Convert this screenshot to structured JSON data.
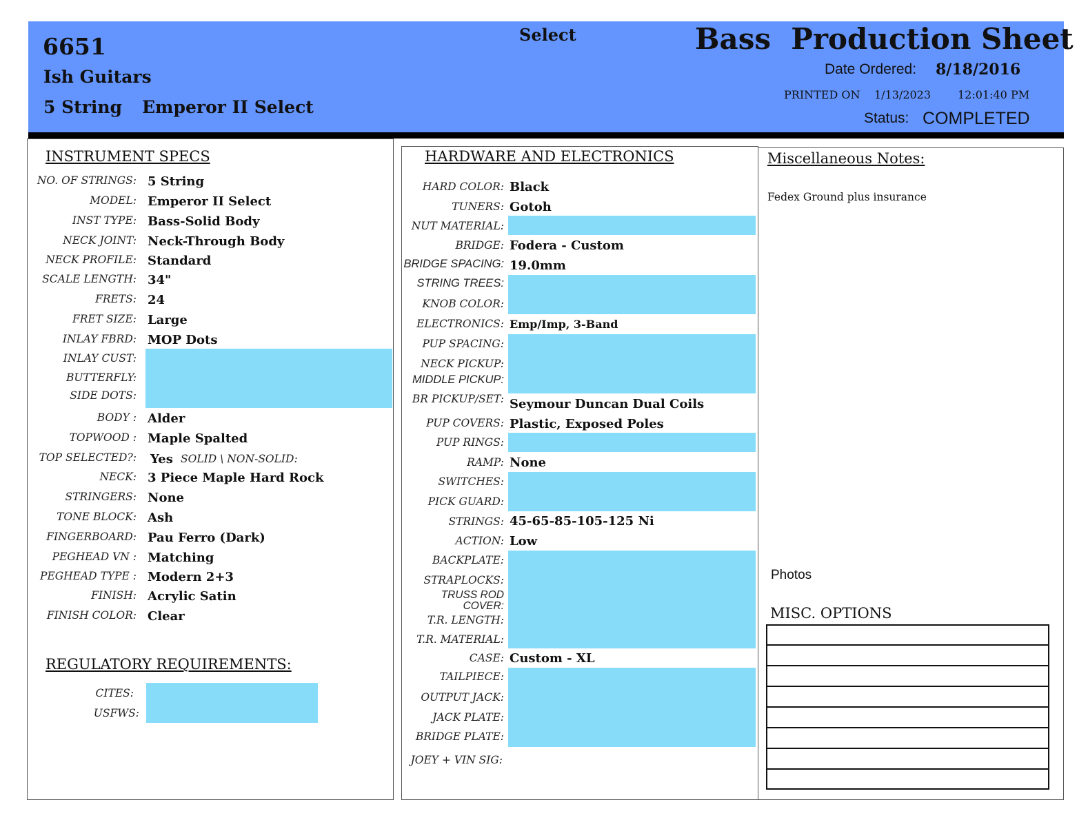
{
  "header": {
    "order_number": "6651",
    "customer": "Ish Guitars",
    "strings": "5 String",
    "model": "Emperor II Select",
    "series": "Select",
    "title": "Bass  Production Sheet",
    "date_ordered_label": "Date Ordered:",
    "date_ordered": "8/18/2016",
    "printed_on_label": "PRINTED ON",
    "printed_date": "1/13/2023",
    "printed_time": "12:01:40 PM",
    "status_label": "Status:",
    "status": "COMPLETED",
    "header_color": "#6495ff"
  },
  "instrument_specs": {
    "title": "INSTRUMENT SPECS",
    "rows": [
      {
        "label": "NO. OF STRINGS:",
        "value": "5 String"
      },
      {
        "label": "MODEL:",
        "value": "Emperor II Select"
      },
      {
        "label": "INST TYPE:",
        "value": "Bass-Solid Body"
      },
      {
        "label": "NECK JOINT:",
        "value": "Neck-Through Body"
      },
      {
        "label": "NECK PROFILE:",
        "value": "Standard"
      },
      {
        "label": "SCALE LENGTH:",
        "value": "34\""
      },
      {
        "label": "FRETS:",
        "value": "24"
      },
      {
        "label": "FRET SIZE:",
        "value": "Large"
      },
      {
        "label": "INLAY FBRD:",
        "value": "MOP Dots"
      },
      {
        "label": "INLAY CUST:",
        "value": ""
      },
      {
        "label": "BUTTERFLY:",
        "value": ""
      },
      {
        "label": "SIDE DOTS:",
        "value": ""
      },
      {
        "label": "BODY :",
        "value": "Alder"
      },
      {
        "label": "TOPWOOD :",
        "value": "Maple Spalted"
      },
      {
        "label": "TOP SELECTED?:",
        "value": "Yes",
        "extra": "SOLID \\ NON-SOLID:"
      },
      {
        "label": "NECK:",
        "value": "3 Piece Maple Hard Rock"
      },
      {
        "label": "STRINGERS:",
        "value": "None"
      },
      {
        "label": "TONE BLOCK:",
        "value": "Ash"
      },
      {
        "label": "FINGERBOARD:",
        "value": "Pau Ferro (Dark)"
      },
      {
        "label": "PEGHEAD VN :",
        "value": "Matching"
      },
      {
        "label": "PEGHEAD TYPE :",
        "value": "Modern 2+3"
      },
      {
        "label": "FINISH:",
        "value": "Acrylic Satin"
      },
      {
        "label": "FINISH COLOR:",
        "value": "Clear"
      }
    ]
  },
  "regulatory": {
    "title": "REGULATORY REQUIREMENTS:",
    "rows": [
      {
        "label": "CITES:",
        "value": ""
      },
      {
        "label": "USFWS:",
        "value": ""
      }
    ]
  },
  "hardware": {
    "title": "HARDWARE AND ELECTRONICS",
    "rows": [
      {
        "label": "HARD COLOR:",
        "value": "Black"
      },
      {
        "label": "TUNERS:",
        "value": "Gotoh"
      },
      {
        "label": "NUT MATERIAL:",
        "value": ""
      },
      {
        "label": "BRIDGE:",
        "value": "Fodera - Custom"
      },
      {
        "label": "BRIDGE SPACING:",
        "value": "19.0mm"
      },
      {
        "label": "STRING TREES:",
        "value": ""
      },
      {
        "label": "KNOB COLOR:",
        "value": ""
      },
      {
        "label": "ELECTRONICS:",
        "value": "Emp/Imp, 3-Band"
      },
      {
        "label": "PUP SPACING:",
        "value": ""
      },
      {
        "label": "NECK PICKUP:",
        "value": ""
      },
      {
        "label": "MIDDLE PICKUP:",
        "value": ""
      },
      {
        "label": "BR PICKUP/SET:",
        "value": "Seymour Duncan Dual Coils"
      },
      {
        "label": "PUP COVERS:",
        "value": "Plastic, Exposed Poles"
      },
      {
        "label": "PUP RINGS:",
        "value": ""
      },
      {
        "label": "RAMP:",
        "value": "None"
      },
      {
        "label": "SWITCHES:",
        "value": ""
      },
      {
        "label": "PICK GUARD:",
        "value": ""
      },
      {
        "label": "STRINGS:",
        "value": "45-65-85-105-125 Ni"
      },
      {
        "label": "ACTION:",
        "value": "Low"
      },
      {
        "label": "BACKPLATE:",
        "value": ""
      },
      {
        "label": "STRAPLOCKS:",
        "value": ""
      },
      {
        "label": "TRUSS ROD COVER:",
        "value": ""
      },
      {
        "label": "T.R. LENGTH:",
        "value": ""
      },
      {
        "label": "T.R. MATERIAL:",
        "value": ""
      },
      {
        "label": "CASE:",
        "value": "Custom - XL"
      },
      {
        "label": "TAILPIECE:",
        "value": ""
      },
      {
        "label": "OUTPUT JACK:",
        "value": ""
      },
      {
        "label": "JACK PLATE:",
        "value": ""
      },
      {
        "label": "BRIDGE PLATE:",
        "value": ""
      },
      {
        "label": "JOEY + VIN SIG:",
        "value": ""
      }
    ]
  },
  "misc": {
    "notes_title": "Miscellaneous Notes:",
    "notes_text": "Fedex Ground plus insurance",
    "photos_label": "Photos",
    "options_title": "MISC. OPTIONS",
    "options": [
      "",
      "",
      "",
      "",
      "",
      "",
      "",
      ""
    ]
  },
  "colors": {
    "empty_field": "#87dcfa"
  }
}
